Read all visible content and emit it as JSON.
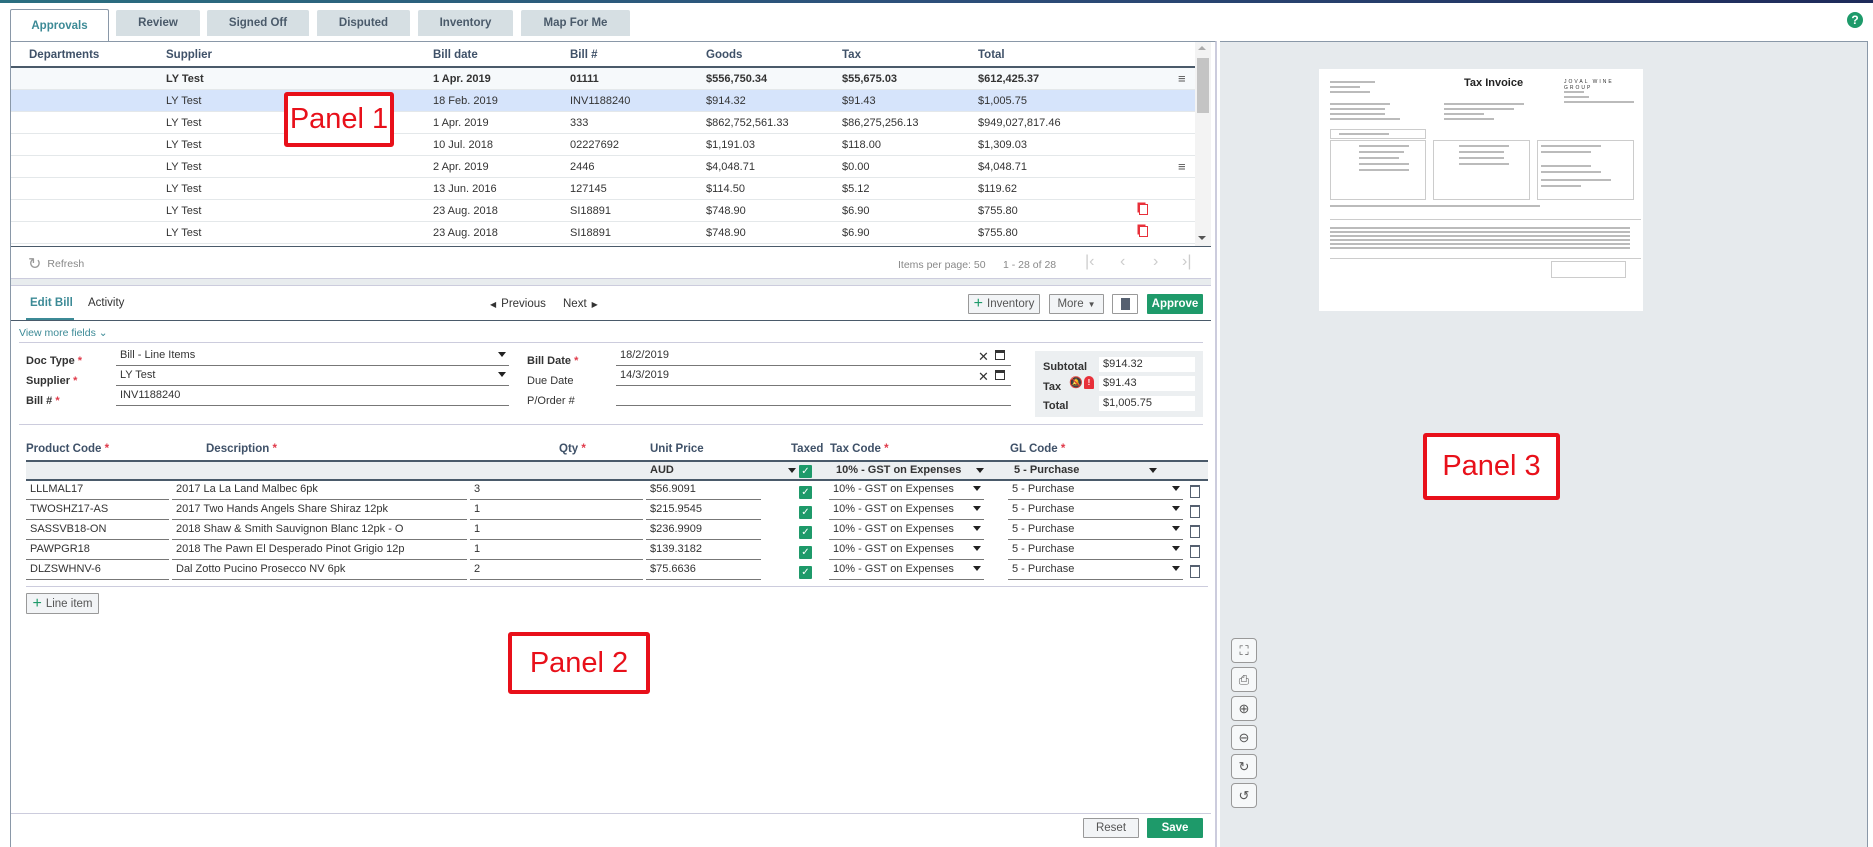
{
  "tabs": [
    "Approvals",
    "Review",
    "Signed Off",
    "Disputed",
    "Inventory",
    "Map For Me"
  ],
  "help_icon": "question-circle-icon",
  "grid": {
    "columns": [
      "Departments",
      "Supplier",
      "Bill date",
      "Bill #",
      "Goods",
      "Tax",
      "Total"
    ],
    "rows": [
      {
        "supplier": "LY Test",
        "date": "1 Apr. 2019",
        "bill": "01111",
        "goods": "$556,750.34",
        "tax": "$55,675.03",
        "total": "$612,425.37",
        "icon": "notes-icon",
        "bold": true
      },
      {
        "supplier": "LY Test",
        "date": "18 Feb. 2019",
        "bill": "INV1188240",
        "goods": "$914.32",
        "tax": "$91.43",
        "total": "$1,005.75",
        "selected": true
      },
      {
        "supplier": "LY Test",
        "date": "1 Apr. 2019",
        "bill": "333",
        "goods": "$862,752,561.33",
        "tax": "$86,275,256.13",
        "total": "$949,027,817.46"
      },
      {
        "supplier": "LY Test",
        "date": "10 Jul. 2018",
        "bill": "02227692",
        "goods": "$1,191.03",
        "tax": "$118.00",
        "total": "$1,309.03"
      },
      {
        "supplier": "LY Test",
        "date": "2 Apr. 2019",
        "bill": "2446",
        "goods": "$4,048.71",
        "tax": "$0.00",
        "total": "$4,048.71",
        "icon": "notes-icon"
      },
      {
        "supplier": "LY Test",
        "date": "13 Jun. 2016",
        "bill": "127145",
        "goods": "$114.50",
        "tax": "$5.12",
        "total": "$119.62"
      },
      {
        "supplier": "LY Test",
        "date": "23 Aug. 2018",
        "bill": "SI18891",
        "goods": "$748.90",
        "tax": "$6.90",
        "total": "$755.80",
        "icon": "duplicate-icon"
      },
      {
        "supplier": "LY Test",
        "date": "23 Aug. 2018",
        "bill": "SI18891",
        "goods": "$748.90",
        "tax": "$6.90",
        "total": "$755.80",
        "icon": "duplicate-icon"
      }
    ],
    "refresh": "Refresh",
    "items_per_page": "Items per page: 50",
    "range": "1 - 28 of 28"
  },
  "edit": {
    "tabs": [
      "Edit Bill",
      "Activity"
    ],
    "previous": "Previous",
    "next": "Next",
    "inventory": "Inventory",
    "more": "More",
    "approve": "Approve",
    "view_more": "View more fields",
    "doc_type_label": "Doc Type",
    "doc_type": "Bill - Line Items",
    "supplier_label": "Supplier",
    "supplier": "LY Test",
    "bill_label": "Bill #",
    "bill": "INV1188240",
    "bill_date_label": "Bill Date",
    "bill_date": "18/2/2019",
    "due_date_label": "Due Date",
    "due_date": "14/3/2019",
    "po_label": "P/Order #",
    "po": "",
    "subtotal_label": "Subtotal",
    "subtotal": "$914.32",
    "tax_label": "Tax",
    "tax": "$91.43",
    "total_label": "Total",
    "total": "$1,005.75",
    "required_mark": "*"
  },
  "lines": {
    "columns": [
      "Product Code",
      "Description",
      "Qty",
      "Unit Price",
      "Taxed",
      "Tax Code",
      "GL Code"
    ],
    "default_currency": "AUD",
    "default_tax": "10% - GST on Expenses",
    "default_gl": "5 - Purchase",
    "items": [
      {
        "code": "LLLMAL17",
        "desc": "2017 La La Land Malbec 6pk",
        "qty": "3",
        "price": "$56.9091",
        "taxed": true,
        "tax": "10% - GST on Expenses",
        "gl": "5 - Purchase"
      },
      {
        "code": "TWOSHZ17-AS",
        "desc": "2017 Two Hands Angels Share Shiraz 12pk",
        "qty": "1",
        "price": "$215.9545",
        "taxed": true,
        "tax": "10% - GST on Expenses",
        "gl": "5 - Purchase"
      },
      {
        "code": "SASSVB18-ON",
        "desc": "2018 Shaw & Smith Sauvignon Blanc 12pk - O",
        "qty": "1",
        "price": "$236.9909",
        "taxed": true,
        "tax": "10% - GST on Expenses",
        "gl": "5 - Purchase"
      },
      {
        "code": "PAWPGR18",
        "desc": "2018 The Pawn El Desperado Pinot Grigio 12p",
        "qty": "1",
        "price": "$139.3182",
        "taxed": true,
        "tax": "10% - GST on Expenses",
        "gl": "5 - Purchase"
      },
      {
        "code": "DLZSWHNV-6",
        "desc": "Dal Zotto Pucino Prosecco NV 6pk",
        "qty": "2",
        "price": "$75.6636",
        "taxed": true,
        "tax": "10% - GST on Expenses",
        "gl": "5 - Purchase"
      }
    ],
    "add_line": "Line item",
    "reset": "Reset",
    "save": "Save"
  },
  "preview": {
    "title": "Tax Invoice",
    "brand": "JOVAL WINE GROUP",
    "tools": [
      "fullscreen-icon",
      "print-icon",
      "zoom-in-icon",
      "zoom-out-icon",
      "rotate-right-icon",
      "rotate-left-icon"
    ]
  },
  "annotations": [
    "Panel 1",
    "Panel 2",
    "Panel 3"
  ],
  "colors": {
    "accent": "#3c8a96",
    "approve": "#1e9a6a",
    "selected_row": "#d6e4fb",
    "alert": "#e8303a"
  }
}
